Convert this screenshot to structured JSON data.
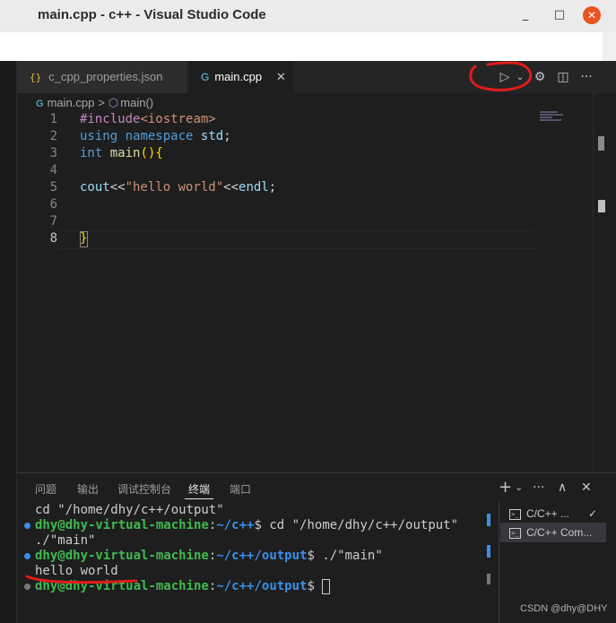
{
  "window": {
    "title": "main.cpp - c++ - Visual Studio Code",
    "minimize": "_",
    "maximize": "□",
    "close": "✕"
  },
  "tabs": [
    {
      "icon": "{}",
      "label": "c_cpp_properties.json"
    },
    {
      "icon": "G",
      "label": "main.cpp",
      "close": "✕"
    }
  ],
  "toolbar": {
    "run_icon": "▷",
    "run_dropdown_icon": "⌄",
    "gear_icon": "⚙",
    "split_icon": "◫",
    "more_icon": "···"
  },
  "breadcrumb": {
    "file_icon": "G",
    "file": "main.cpp",
    "separator": ">",
    "symbol": "main()"
  },
  "editor": {
    "line_numbers": [
      "1",
      "2",
      "3",
      "4",
      "5",
      "6",
      "7",
      "8"
    ],
    "lines": {
      "l1_a": "#include",
      "l1_b": "<iostream>",
      "l2_a": "using",
      "l2_b": "namespace",
      "l2_c": "std",
      "l2_d": ";",
      "l3_a": "int",
      "l3_b": "main",
      "l3_c": "()",
      "l3_d": "{",
      "l5_a": "cout",
      "l5_b": "<<",
      "l5_c": "\"hello world\"",
      "l5_d": "<<",
      "l5_e": "endl",
      "l5_f": ";",
      "l8_a": "}"
    }
  },
  "panel": {
    "tabs": [
      "问题",
      "输出",
      "调试控制台",
      "终端",
      "端口"
    ],
    "active_tab": "终端",
    "icons": {
      "add": "+",
      "dropdown": "⌄",
      "more": "···",
      "maximize": "∧",
      "close": "✕"
    }
  },
  "terminal": {
    "line1": "cd \"/home/dhy/c++/output\"",
    "prompt_user": "dhy@dhy-virtual-machine",
    "colon": ":",
    "path1": "~/c++",
    "cmd1": "$ cd \"/home/dhy/c++/output\"",
    "line3": "./\"main\"",
    "path2": "~/c++/output",
    "cmd2": "$ ./\"main\"",
    "output": "hello world",
    "path3": "~/c++/output",
    "cmd3": "$ "
  },
  "terminal_list": [
    {
      "label": "C/C++ ...",
      "check": "✓"
    },
    {
      "label": "C/C++ Com..."
    }
  ],
  "watermark": "CSDN @dhy@DHY",
  "colors": {
    "annotation_red": "#e21b1b",
    "accent_blue": "#3b8eea",
    "prompt_green": "#3fb950",
    "ubuntu_close": "#e95420"
  }
}
